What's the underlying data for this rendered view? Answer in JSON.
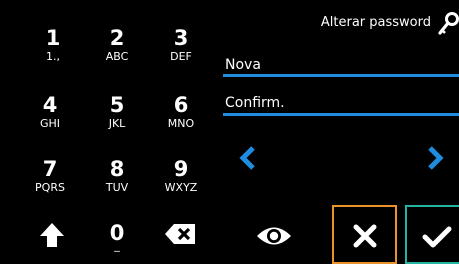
{
  "header": {
    "title": "Alterar password",
    "icon": "key-icon"
  },
  "keypad": {
    "keys": [
      {
        "digit": "1",
        "letters": "1.,"
      },
      {
        "digit": "2",
        "letters": "ABC"
      },
      {
        "digit": "3",
        "letters": "DEF"
      },
      {
        "digit": "4",
        "letters": "GHI"
      },
      {
        "digit": "5",
        "letters": "JKL"
      },
      {
        "digit": "6",
        "letters": "MNO"
      },
      {
        "digit": "7",
        "letters": "PQRS"
      },
      {
        "digit": "8",
        "letters": "TUV"
      },
      {
        "digit": "9",
        "letters": "WXYZ"
      },
      {
        "digit": "0",
        "letters": "_"
      }
    ],
    "shift_icon": "arrow-up-icon",
    "backspace_icon": "backspace-icon"
  },
  "fields": {
    "new_label": "Nova",
    "confirm_label": "Confirm."
  },
  "nav": {
    "left_icon": "chevron-left-icon",
    "right_icon": "chevron-right-icon"
  },
  "actions": {
    "show_icon": "eye-icon",
    "cancel_icon": "close-icon",
    "confirm_icon": "check-icon"
  },
  "colors": {
    "background": "#000000",
    "accent_blue": "#1f8ce0",
    "cancel_border": "#e8922c",
    "confirm_border": "#25b3a2"
  }
}
